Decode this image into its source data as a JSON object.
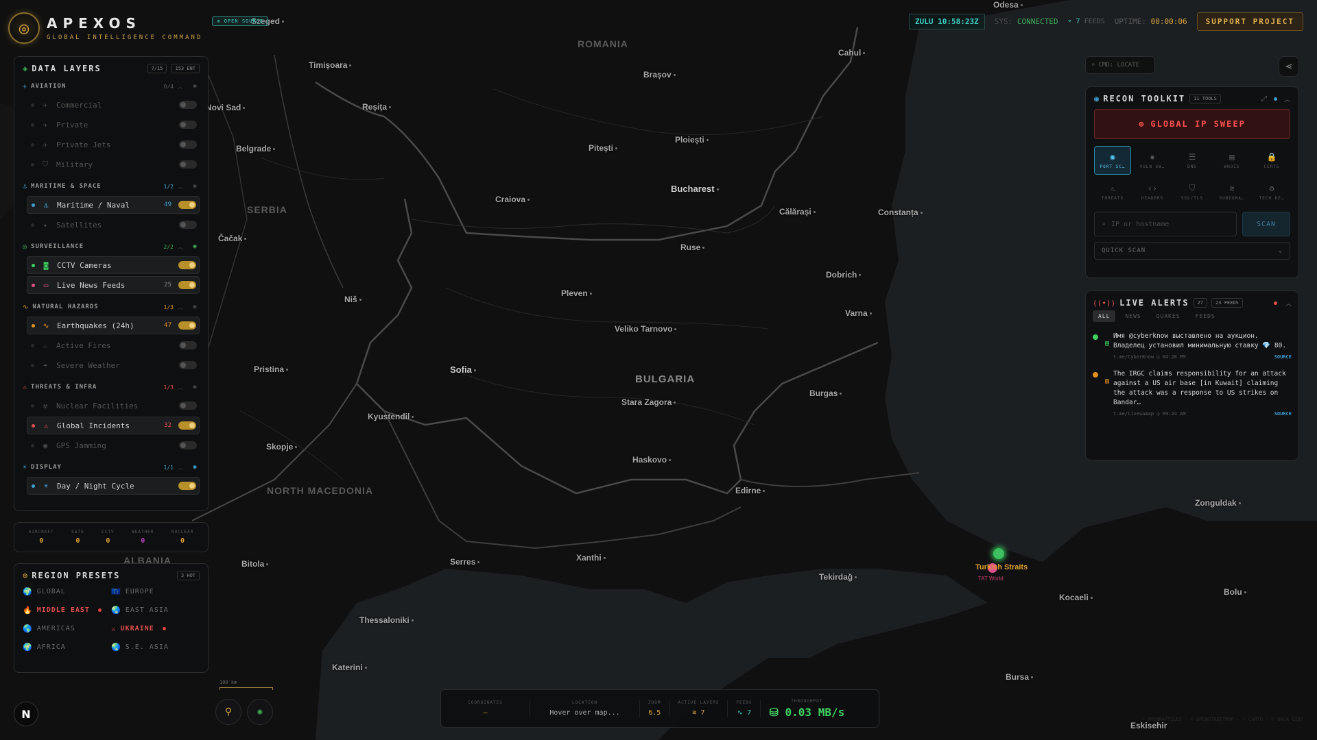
{
  "brand": {
    "title": "APEXOS",
    "subtitle": "GLOBAL INTELLIGENCE COMMAND",
    "badge": "OPEN SOURCE"
  },
  "topbar": {
    "zulu": "ZULU 10:58:23Z",
    "sys_label": "SYS:",
    "sys_status": "CONNECTED",
    "feeds_count": "7",
    "feeds_label": "FEEDS",
    "uptime_label": "UPTIME:",
    "uptime_value": "00:00:06",
    "support_label": "SUPPORT PROJECT"
  },
  "layers": {
    "title": "DATA LAYERS",
    "count": "7/15",
    "entities": "153 ENT",
    "groups": [
      {
        "name": "AVIATION",
        "count": "0/4",
        "items": [
          {
            "label": "Commercial",
            "count": ""
          },
          {
            "label": "Private",
            "count": ""
          },
          {
            "label": "Private Jets",
            "count": ""
          },
          {
            "label": "Military",
            "count": ""
          }
        ]
      },
      {
        "name": "MARITIME & SPACE",
        "count": "1/2",
        "items": [
          {
            "label": "Maritime / Naval",
            "count": "49"
          },
          {
            "label": "Satellites",
            "count": ""
          }
        ]
      },
      {
        "name": "SURVEILLANCE",
        "count": "2/2",
        "items": [
          {
            "label": "CCTV Cameras",
            "count": ""
          },
          {
            "label": "Live News Feeds",
            "count": "25"
          }
        ]
      },
      {
        "name": "NATURAL HAZARDS",
        "count": "1/3",
        "items": [
          {
            "label": "Earthquakes (24h)",
            "count": "47"
          },
          {
            "label": "Active Fires",
            "count": ""
          },
          {
            "label": "Severe Weather",
            "count": ""
          }
        ]
      },
      {
        "name": "THREATS & INFRA",
        "count": "1/3",
        "items": [
          {
            "label": "Nuclear Facilities",
            "count": ""
          },
          {
            "label": "Global Incidents",
            "count": "32"
          },
          {
            "label": "GPS Jamming",
            "count": ""
          }
        ]
      },
      {
        "name": "DISPLAY",
        "count": "1/1",
        "items": [
          {
            "label": "Day / Night Cycle",
            "count": ""
          }
        ]
      }
    ]
  },
  "stats": [
    {
      "label": "AIRCRAFT",
      "value": "0",
      "color": "#e0a030"
    },
    {
      "label": "SATS",
      "value": "0",
      "color": "#e0a030"
    },
    {
      "label": "CCTV",
      "value": "0",
      "color": "#e0a030"
    },
    {
      "label": "WEATHER",
      "value": "0",
      "color": "#c040c0"
    },
    {
      "label": "NUCLEAR",
      "value": "0",
      "color": "#e0a030"
    }
  ],
  "regions": {
    "title": "REGION PRESETS",
    "badge": "3 HOT",
    "items": [
      {
        "label": "GLOBAL",
        "icon": "🌍",
        "hot": false
      },
      {
        "label": "EUROPE",
        "icon": "🇪🇺",
        "hot": false
      },
      {
        "label": "MIDDLE EAST",
        "icon": "🔥",
        "hot": true
      },
      {
        "label": "EAST ASIA",
        "icon": "🌏",
        "hot": false
      },
      {
        "label": "AMERICAS",
        "icon": "🌎",
        "hot": false
      },
      {
        "label": "UKRAINE",
        "icon": "⚔",
        "hot": true
      },
      {
        "label": "AFRICA",
        "icon": "🌍",
        "hot": false
      },
      {
        "label": "S.E. ASIA",
        "icon": "🌏",
        "hot": false
      }
    ]
  },
  "cmd": {
    "placeholder": "CMD: LOCATE"
  },
  "recon": {
    "title": "RECON TOOLKIT",
    "badge": "11 TOOLS",
    "sweep_label": "GLOBAL IP SWEEP",
    "tools": [
      {
        "label": "PORT SC…",
        "icon": "◉"
      },
      {
        "label": "VULN SW…",
        "icon": "✹"
      },
      {
        "label": "DNS",
        "icon": "☰"
      },
      {
        "label": "WHOIS",
        "icon": "▤"
      },
      {
        "label": "CERTS",
        "icon": "🔒"
      },
      {
        "label": "THREATS",
        "icon": "⚠"
      },
      {
        "label": "HEADERS",
        "icon": "‹›"
      },
      {
        "label": "SSL/TLS",
        "icon": "⛉"
      },
      {
        "label": "SUBDOMA…",
        "icon": "≋"
      },
      {
        "label": "TECH DE…",
        "icon": "⚙"
      }
    ],
    "ip_placeholder": "IP or hostname",
    "scan_label": "SCAN",
    "quick_scan": "QUICK SCAN"
  },
  "alerts": {
    "title": "LIVE ALERTS",
    "count": "27",
    "feeds": "23 FEEDS",
    "tabs": [
      "ALL",
      "NEWS",
      "QUAKES",
      "FEEDS"
    ],
    "items": [
      {
        "text": "Имя @cyberknow выставлено на аукцион. Владелец установил минимальную ставку 💎 80.",
        "source": "t.me/CyberKnow",
        "time": "04:28 PM",
        "link": "SOURCE",
        "color": "#3fd060"
      },
      {
        "text": "The IRGC claims responsibility for an attack against a US air base [in Kuwait] claiming the attack was a response to US strikes on Bandar…",
        "source": "t.me/Liveuamap",
        "time": "09:24 AM",
        "link": "SOURCE",
        "color": "#e09020"
      }
    ]
  },
  "statusbar": {
    "coordinates_label": "COORDINATES",
    "coordinates": "—",
    "location_label": "LOCATION",
    "location": "Hover over map...",
    "zoom_label": "ZOOM",
    "zoom": "6.5",
    "layers_label": "ACTIVE LAYERS",
    "layers": "7",
    "feeds_label": "FEEDS",
    "feeds": "7",
    "throughput_label": "THROUGHPUT",
    "throughput": "0.03 MB/s"
  },
  "scale": "100 km",
  "map": {
    "countries": [
      "ROMANIA",
      "SERBIA",
      "BULGARIA",
      "NORTH MACEDONIA",
      "ALBANIA"
    ],
    "cities": [
      "Szeged",
      "Odesa",
      "Timișoara",
      "Novi Sad",
      "Reșița",
      "Cahul",
      "Brașov",
      "Belgrade",
      "Pitești",
      "Ploiești",
      "Bucharest",
      "Craiova",
      "Călărași",
      "Constanța",
      "Čačak",
      "Ruse",
      "Dobrich",
      "Niš",
      "Pleven",
      "Varna",
      "Veliko Tarnovo",
      "Pristina",
      "Sofia",
      "Burgas",
      "Kyustendil",
      "Stara Zagora",
      "Skopje",
      "Haskovo",
      "Edirne",
      "Zonguldak",
      "Bitola",
      "Serres",
      "Xanthi",
      "Tekirdağ",
      "Bolu",
      "Kocaeli",
      "Thessaloniki",
      "Katerini",
      "Bursa",
      "Eskisehir",
      "Turkish Straits"
    ],
    "marker_label": "Turkish Straits",
    "marker_sub": "TAT World"
  },
  "brand_n": "N",
  "credits": "© OPENMAPTILES · © OPENSTREETMAP · © CARTO · © NASA GIBS"
}
